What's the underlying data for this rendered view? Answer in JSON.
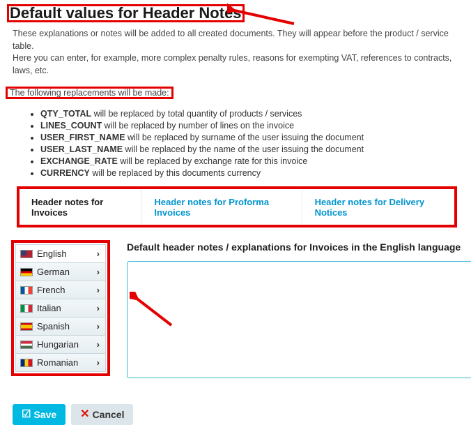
{
  "title": "Default values for Header Notes",
  "intro1": "These explanations or notes will be added to all created documents. They will appear before the product / service table.",
  "intro2": "Here you can enter, for example, more complex penalty rules, reasons for exempting VAT, references to contracts, laws, etc.",
  "replace_label": "The following replacements will be made:",
  "replacements": [
    {
      "token": "QTY_TOTAL",
      "desc": " will be replaced by total quantity of products / services"
    },
    {
      "token": "LINES_COUNT",
      "desc": " will be replaced by number of lines on the invoice"
    },
    {
      "token": "USER_FIRST_NAME",
      "desc": " will be replaced by surname of the user issuing the document"
    },
    {
      "token": "USER_LAST_NAME",
      "desc": " will be replaced by the name of the user issuing the document"
    },
    {
      "token": "EXCHANGE_RATE",
      "desc": " will be replaced by exchange rate for this invoice"
    },
    {
      "token": "CURRENCY",
      "desc": " will be replaced by this documents currency"
    }
  ],
  "tabs": [
    {
      "label": "Header notes for Invoices",
      "active": true
    },
    {
      "label": "Header notes for Proforma Invoices",
      "active": false
    },
    {
      "label": "Header notes for Delivery Notices",
      "active": false
    }
  ],
  "languages": [
    {
      "label": "English",
      "flag": "en",
      "active": true
    },
    {
      "label": "German",
      "flag": "de",
      "active": false
    },
    {
      "label": "French",
      "flag": "fr",
      "active": false
    },
    {
      "label": "Italian",
      "flag": "it",
      "active": false
    },
    {
      "label": "Spanish",
      "flag": "es",
      "active": false
    },
    {
      "label": "Hungarian",
      "flag": "hu",
      "active": false
    },
    {
      "label": "Romanian",
      "flag": "ro",
      "active": false
    }
  ],
  "content_heading": "Default header notes / explanations for Invoices in the English language",
  "textarea_value": "",
  "buttons": {
    "save": "Save",
    "cancel": "Cancel"
  },
  "colors": {
    "accent": "#00b9e2",
    "annotation": "#e40000"
  }
}
